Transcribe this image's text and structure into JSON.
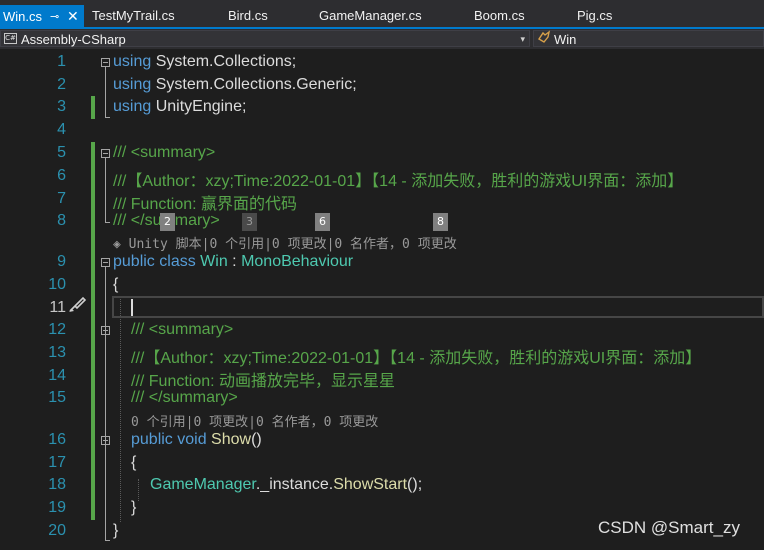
{
  "tabs": [
    {
      "label": "Win.cs",
      "pin": "⊸",
      "close": "✕"
    },
    {
      "label": "TestMyTrail.cs"
    },
    {
      "label": "Bird.cs"
    },
    {
      "label": "GameManager.cs"
    },
    {
      "label": "Boom.cs"
    },
    {
      "label": "Pig.cs"
    }
  ],
  "navbar": {
    "project_icon": "C#",
    "project": "Assembly-CSharp",
    "member": "Win",
    "dropdown_arrow": "▾",
    "member_icon": "unity-class-icon"
  },
  "lines": [
    "1",
    "2",
    "3",
    "4",
    "5",
    "6",
    "7",
    "8",
    "9",
    "10",
    "11",
    "12",
    "13",
    "14",
    "15",
    "16",
    "17",
    "18",
    "19",
    "20"
  ],
  "code": {
    "l1a": "using",
    "l1b": " System.Collections;",
    "l2a": "using",
    "l2b": " System.Collections.Generic;",
    "l3a": "using",
    "l3b": " UnityEngine;",
    "l5a": "/// ",
    "l5b": "<summary>",
    "l6": "///【Author：xzy;Time:2022-01-01】【14 - 添加失败，胜利的游戏UI界面：添加】",
    "l7": "/// Function: 赢界面的代码",
    "l8a": "/// ",
    "l8b": "</summary>",
    "lens1": "Unity 脚本|0 个引用|0 项更改|0 名作者，0 项更改",
    "lens1_icon": "◈",
    "l9a": "public",
    "l9b": " class",
    "l9c": " Win",
    "l9d": " : ",
    "l9e": "MonoBehaviour",
    "l10": "{",
    "l12a": "/// ",
    "l12b": "<summary>",
    "l13": "///【Author：xzy;Time:2022-01-01】【14 - 添加失败，胜利的游戏UI界面：添加】",
    "l14": "/// Function: 动画播放完毕，显示星星",
    "l15a": "/// ",
    "l15b": "</summary>",
    "lens2": "0 个引用|0 项更改|0 名作者，0 项更改",
    "l16a": "public",
    "l16b": " void",
    "l16c": " Show",
    "l16d": "()",
    "l17": "{",
    "l18a": "GameManager",
    "l18b": "._instance.",
    "l18c": "ShowStart",
    "l18d": "();",
    "l19": "}",
    "l20": "}"
  },
  "badges": [
    "2",
    "3",
    "6",
    "8"
  ],
  "watermark": "CSDN @Smart_zy",
  "colors": {
    "accent": "#007acc",
    "keyword": "#569cd6",
    "type": "#4ec9b0",
    "comment": "#57a64a",
    "method": "#dcdcaa",
    "line_number": "#2b91af"
  }
}
